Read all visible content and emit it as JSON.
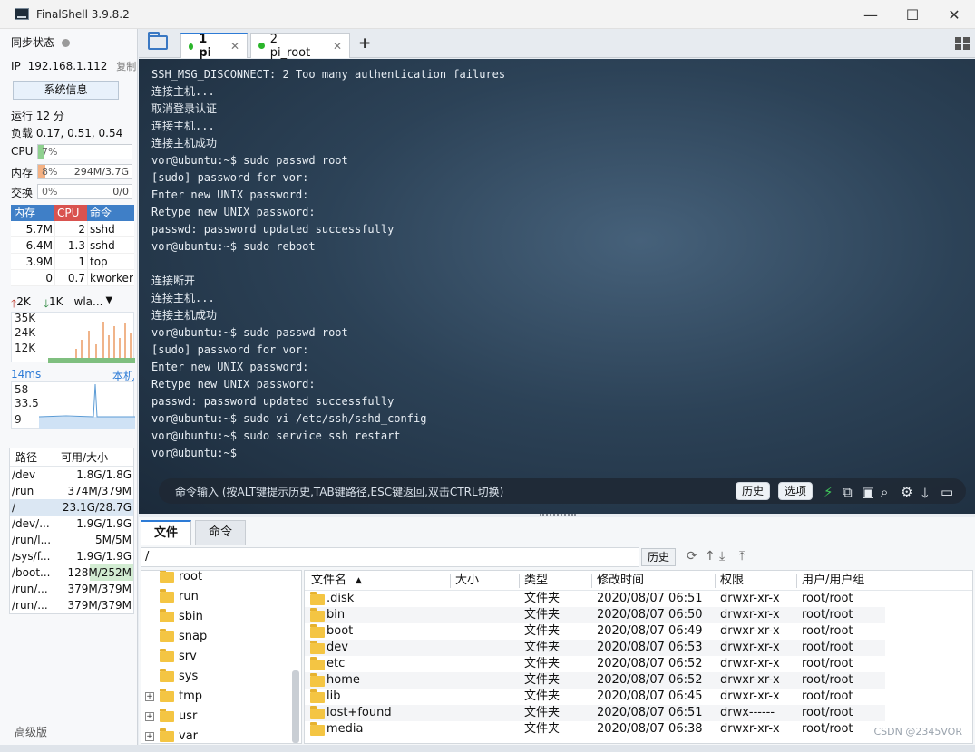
{
  "window": {
    "title": "FinalShell 3.9.8.2",
    "minimize": "—",
    "maximize": "☐",
    "close": "✕"
  },
  "sidebar": {
    "sync_label": "同步状态",
    "ip_label": "IP",
    "ip_value": "192.168.1.112",
    "copy_label": "复制",
    "sysinfo_button": "系统信息",
    "uptime": "运行 12 分",
    "load": "负载 0.17, 0.51, 0.54",
    "cpu": {
      "label": "CPU",
      "text": "7%",
      "fraction": 0.07
    },
    "mem": {
      "label": "内存",
      "text": "8%",
      "detail": "294M/3.7G",
      "fraction": 0.08
    },
    "swap": {
      "label": "交换",
      "text": "0%",
      "detail": "0/0",
      "fraction": 0
    },
    "process_headers": [
      "内存",
      "CPU",
      "命令"
    ],
    "processes": [
      {
        "mem": "5.7M",
        "cpu": "2",
        "cmd": "sshd"
      },
      {
        "mem": "6.4M",
        "cpu": "1.3",
        "cmd": "sshd"
      },
      {
        "mem": "3.9M",
        "cpu": "1",
        "cmd": "top"
      },
      {
        "mem": "0",
        "cpu": "0.7",
        "cmd": "kworker"
      }
    ],
    "net": {
      "up": "2K",
      "down": "1K",
      "iface": "wla...",
      "ticks": [
        "35K",
        "24K",
        "12K"
      ]
    },
    "latency": {
      "current": "14ms",
      "host": "本机",
      "ticks": [
        "58",
        "33.5",
        "9"
      ]
    },
    "disk_headers": [
      "路径",
      "可用/大小"
    ],
    "disks": [
      {
        "path": "/dev",
        "size": "1.8G/1.8G"
      },
      {
        "path": "/run",
        "size": "374M/379M"
      },
      {
        "path": "/",
        "size": "23.1G/28.7G"
      },
      {
        "path": "/dev/...",
        "size": "1.9G/1.9G"
      },
      {
        "path": "/run/l...",
        "size": "5M/5M"
      },
      {
        "path": "/sys/f...",
        "size": "1.9G/1.9G"
      },
      {
        "path": "/boot...",
        "size": "128M/252M"
      },
      {
        "path": "/run/...",
        "size": "379M/379M"
      },
      {
        "path": "/run/...",
        "size": "379M/379M"
      }
    ],
    "advanced": "高级版"
  },
  "tabs": [
    {
      "label": "1 pi",
      "close": "✕"
    },
    {
      "label": "2 pi_root",
      "close": "✕"
    }
  ],
  "add_tab": "+",
  "terminal_lines": [
    "SSH_MSG_DISCONNECT: 2 Too many authentication failures",
    "连接主机...",
    "取消登录认证",
    "连接主机...",
    "连接主机成功",
    "vor@ubuntu:~$ sudo passwd root",
    "[sudo] password for vor:",
    "Enter new UNIX password:",
    "Retype new UNIX password:",
    "passwd: password updated successfully",
    "vor@ubuntu:~$ sudo reboot",
    "",
    "连接断开",
    "连接主机...",
    "连接主机成功",
    "vor@ubuntu:~$ sudo passwd root",
    "[sudo] password for vor:",
    "Enter new UNIX password:",
    "Retype new UNIX password:",
    "passwd: password updated successfully",
    "vor@ubuntu:~$ sudo vi /etc/ssh/sshd_config",
    "vor@ubuntu:~$ sudo service ssh restart",
    "vor@ubuntu:~$"
  ],
  "command_bar": {
    "placeholder": "命令输入 (按ALT键提示历史,TAB键路径,ESC键返回,双击CTRL切换)",
    "history_button": "历史",
    "options_button": "选项"
  },
  "bottom": {
    "tabs": [
      "文件",
      "命令"
    ],
    "path": "/",
    "history_button": "历史",
    "tree": [
      {
        "name": "root",
        "expandable": false
      },
      {
        "name": "run",
        "expandable": false
      },
      {
        "name": "sbin",
        "expandable": false
      },
      {
        "name": "snap",
        "expandable": false
      },
      {
        "name": "srv",
        "expandable": false
      },
      {
        "name": "sys",
        "expandable": false
      },
      {
        "name": "tmp",
        "expandable": true
      },
      {
        "name": "usr",
        "expandable": true
      },
      {
        "name": "var",
        "expandable": true
      }
    ],
    "columns": [
      "文件名",
      "大小",
      "类型",
      "修改时间",
      "权限",
      "用户/用户组"
    ],
    "files": [
      {
        "name": ".disk",
        "type": "文件夹",
        "time": "2020/08/07 06:51",
        "perm": "drwxr-xr-x",
        "owner": "root/root"
      },
      {
        "name": "bin",
        "type": "文件夹",
        "time": "2020/08/07 06:50",
        "perm": "drwxr-xr-x",
        "owner": "root/root"
      },
      {
        "name": "boot",
        "type": "文件夹",
        "time": "2020/08/07 06:49",
        "perm": "drwxr-xr-x",
        "owner": "root/root"
      },
      {
        "name": "dev",
        "type": "文件夹",
        "time": "2020/08/07 06:53",
        "perm": "drwxr-xr-x",
        "owner": "root/root"
      },
      {
        "name": "etc",
        "type": "文件夹",
        "time": "2020/08/07 06:52",
        "perm": "drwxr-xr-x",
        "owner": "root/root"
      },
      {
        "name": "home",
        "type": "文件夹",
        "time": "2020/08/07 06:52",
        "perm": "drwxr-xr-x",
        "owner": "root/root"
      },
      {
        "name": "lib",
        "type": "文件夹",
        "time": "2020/08/07 06:45",
        "perm": "drwxr-xr-x",
        "owner": "root/root"
      },
      {
        "name": "lost+found",
        "type": "文件夹",
        "time": "2020/08/07 06:51",
        "perm": "drwx------",
        "owner": "root/root"
      },
      {
        "name": "media",
        "type": "文件夹",
        "time": "2020/08/07 06:38",
        "perm": "drwxr-xr-x",
        "owner": "root/root"
      }
    ]
  },
  "watermark": "CSDN @2345VOR",
  "colors": {
    "accent": "#2d7bd6",
    "cpu_fill": "#8fd08f",
    "mem_fill": "#f4b183",
    "proc_mem_header": "#3f7fc7",
    "proc_cpu_header": "#d9534f",
    "folder": "#f4c543"
  }
}
